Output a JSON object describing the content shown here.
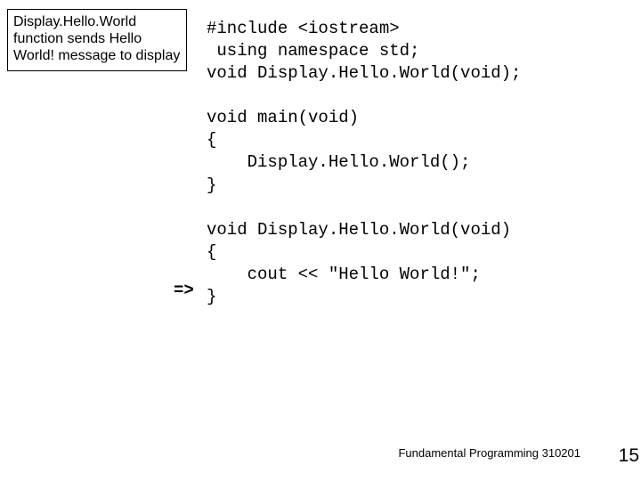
{
  "annotation": {
    "text": "Display.Hello.World function sends Hello World! message to display"
  },
  "code": {
    "block": "#include <iostream>\n using namespace std;\nvoid Display.Hello.World(void);\n\nvoid main(void)\n{\n    Display.Hello.World();\n}\n\nvoid Display.Hello.World(void)\n{\n    cout << \"Hello World!\";\n}"
  },
  "arrow": "=>",
  "footer": {
    "text": "Fundamental Programming 310201",
    "page": "15"
  }
}
